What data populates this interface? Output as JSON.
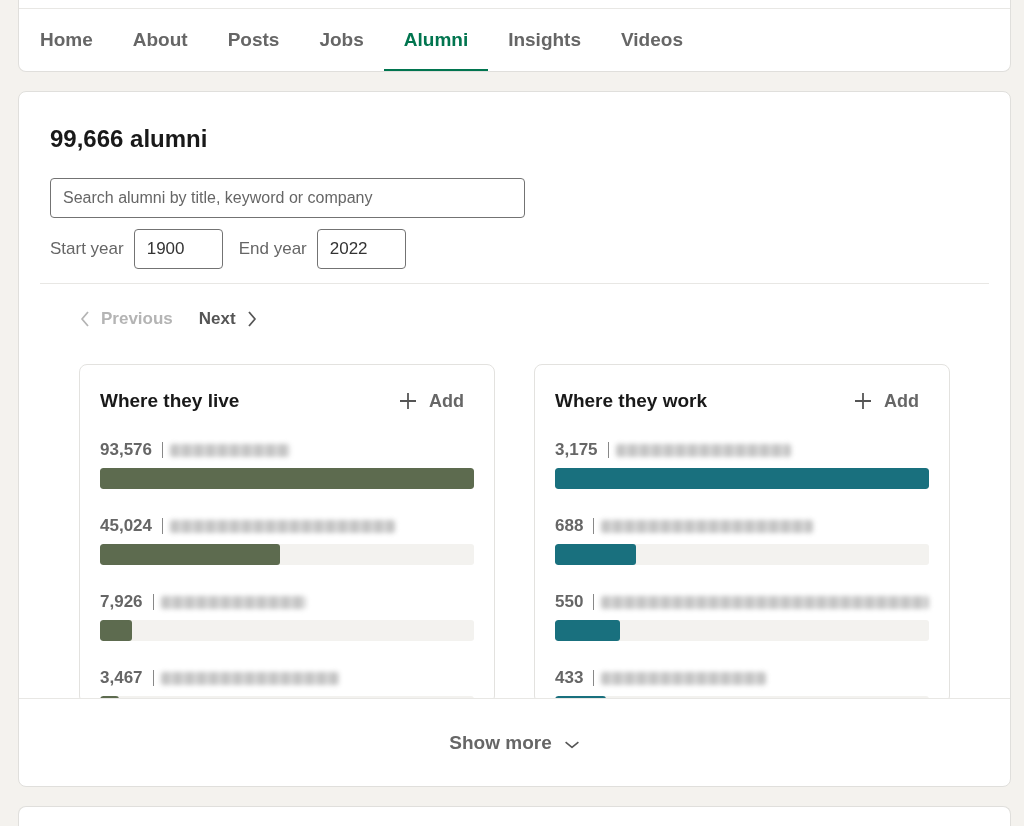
{
  "tabs": [
    {
      "label": "Home",
      "selected": false
    },
    {
      "label": "About",
      "selected": false
    },
    {
      "label": "Posts",
      "selected": false
    },
    {
      "label": "Jobs",
      "selected": false
    },
    {
      "label": "Alumni",
      "selected": true
    },
    {
      "label": "Insights",
      "selected": false
    },
    {
      "label": "Videos",
      "selected": false
    }
  ],
  "alumni": {
    "title": "99,666 alumni",
    "search": {
      "placeholder": "Search alumni by title, keyword or company"
    },
    "start_year": {
      "label": "Start year",
      "value": "1900"
    },
    "end_year": {
      "label": "End year",
      "value": "2022"
    },
    "pagination": {
      "previous": {
        "label": "Previous",
        "disabled": true
      },
      "next": {
        "label": "Next",
        "disabled": false
      }
    },
    "cards": [
      {
        "title": "Where they live",
        "add_label": "Add",
        "color": "#5d6b4f",
        "rows": [
          {
            "count": "93,576",
            "level": 1
          },
          {
            "count": "45,024",
            "level": 0.48
          },
          {
            "count": "7,926",
            "level": 0.085
          },
          {
            "count": "3,467",
            "level": 0.05
          }
        ]
      },
      {
        "title": "Where they work",
        "add_label": "Add",
        "color": "#19707e",
        "rows": [
          {
            "count": "3,175",
            "level": 1
          },
          {
            "count": "688",
            "level": 0.217
          },
          {
            "count": "550",
            "level": 0.174
          },
          {
            "count": "433",
            "level": 0.136
          }
        ]
      }
    ],
    "show_more": "Show more"
  }
}
